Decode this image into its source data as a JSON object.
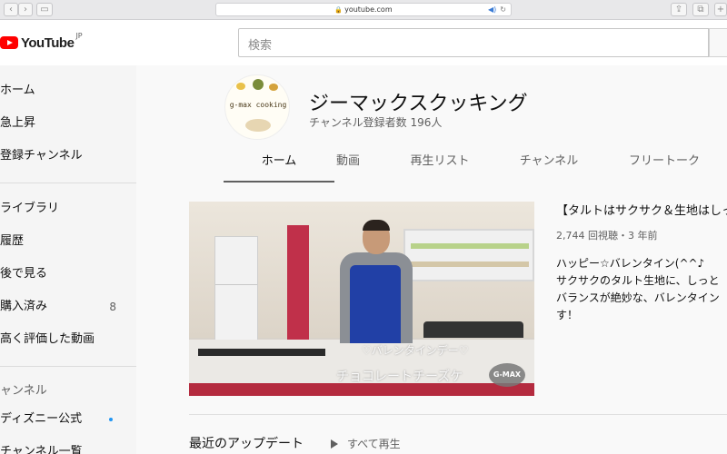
{
  "browser": {
    "url": "youtube.com"
  },
  "header": {
    "logo_text": "YouTube",
    "region": "JP",
    "search_placeholder": "検索"
  },
  "sidebar": {
    "items": [
      {
        "label": "ホーム"
      },
      {
        "label": "急上昇"
      },
      {
        "label": "登録チャンネル"
      },
      {
        "label": "ライブラリ"
      },
      {
        "label": "履歴"
      },
      {
        "label": "後で見る"
      },
      {
        "label": "購入済み",
        "count": "8"
      },
      {
        "label": "高く評価した動画"
      }
    ],
    "section_title": "ャンネル",
    "subscriptions": [
      {
        "label": "ディズニー公式"
      },
      {
        "label": "チャンネル一覧"
      }
    ]
  },
  "channel": {
    "avatar_text": "g-max cooking",
    "name": "ジーマックスクッキング",
    "subscribers": "チャンネル登録者数 196人",
    "tabs": [
      "ホーム",
      "動画",
      "再生リスト",
      "チャンネル",
      "フリートーク"
    ]
  },
  "featured": {
    "overlay_line1": "♡バレンタインデー♡",
    "overlay_line2": "チョコレートチーズケ",
    "badge": "G-MAX",
    "title": "【タルトはサクサク＆生地はしっ",
    "meta": "2,744 回視聴・3 年前",
    "description": [
      "ハッピー☆バレンタイン(^^♪",
      "サクサクのタルト生地に、しっと",
      "バランスが絶妙な、バレンタイン",
      "す！"
    ]
  },
  "recent": {
    "title": "最近のアップデート",
    "play_all": "すべて再生"
  },
  "colors": {
    "youtube_red": "#ff0000",
    "subscription_dot": "#2196f3"
  }
}
